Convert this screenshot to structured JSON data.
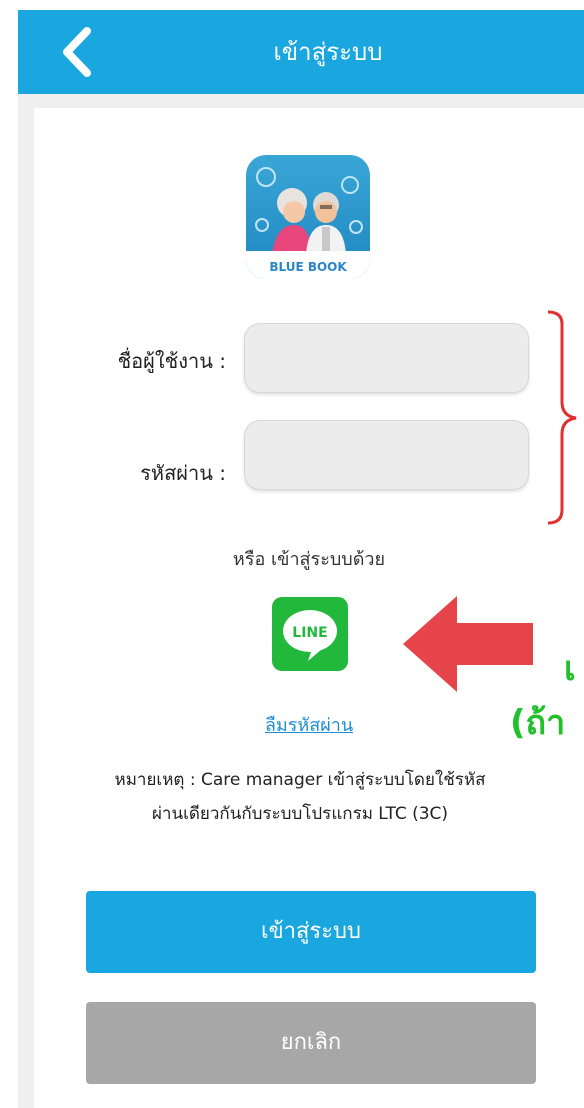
{
  "header": {
    "title": "เข้าสู่ระบบ",
    "back_icon": "chevron-left-icon"
  },
  "logo": {
    "caption": "BLUE BOOK"
  },
  "form": {
    "username_label": "ชื่อผู้ใช้งาน :",
    "username_value": "",
    "password_label": "รหัสผ่าน :",
    "password_value": ""
  },
  "alt_login": {
    "text": "หรือ เข้าสู่ระบบด้วย",
    "line_label": "LINE"
  },
  "annotation": {
    "partial_text_1": "เ",
    "partial_text_2": "(ถ้า"
  },
  "forgot_password": "ลืมรหัสผ่าน",
  "note": {
    "line1": "หมายเหตุ : Care manager เข้าสู่ระบบโดยใช้รหัส",
    "line2": "ผ่านเดียวกันกับระบบโปรแกรม LTC (3C)"
  },
  "buttons": {
    "login": "เข้าสู่ระบบ",
    "cancel": "ยกเลิก"
  },
  "colors": {
    "primary": "#1aa6df",
    "cancel": "#a7a7a7",
    "line_green": "#22b83b",
    "link": "#1b8fd6",
    "arrow_red": "#e5454a",
    "bracket_red": "#e03030",
    "annotation_green": "#22c02a"
  }
}
